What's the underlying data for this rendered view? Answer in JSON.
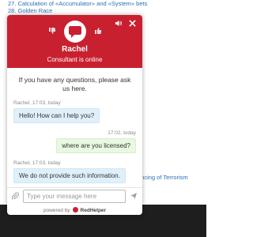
{
  "background": {
    "links": [
      "27. Calculation of «Accumulator» and «System» bets",
      "28. Golden Race"
    ],
    "footer_text": "ancing of Terrorism"
  },
  "chat": {
    "agent_name": "Rachel",
    "agent_status": "Consultant is online",
    "intro": "If you have any questions, please ask us here.",
    "messages": [
      {
        "meta": "Rachel, 17:03, today",
        "text": "Hello! How can I help you?",
        "side": "agent"
      },
      {
        "meta": "17:02, today",
        "text": "where are you licensed?",
        "side": "visitor"
      },
      {
        "meta": "Rachel, 17:03, today",
        "text": "We do not provide such information.",
        "side": "agent"
      }
    ],
    "input_placeholder": "Type your message here",
    "input_value": "",
    "powered_by": "powered by",
    "brand": "RedHelper"
  },
  "icons": {
    "sound": "speaker-icon",
    "close": "close-icon",
    "thumb_down": "thumb-down-icon",
    "thumb_up": "thumb-up-icon",
    "attach": "paperclip-icon",
    "send": "send-icon"
  },
  "colors": {
    "header": "#c9202f",
    "agent_bubble": "#dff0fb",
    "visitor_bubble": "#e9f8e1",
    "link": "#2a6fb3"
  }
}
